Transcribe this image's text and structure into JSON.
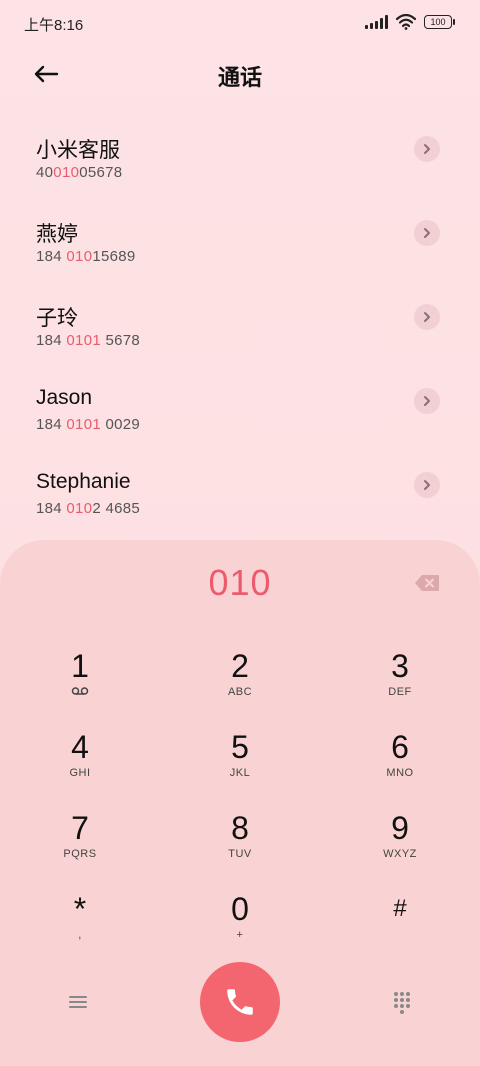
{
  "status": {
    "time": "上午8:16",
    "battery": "100"
  },
  "header": {
    "title": "通话"
  },
  "contacts": [
    {
      "name": "小米客服",
      "num_pre": "40",
      "num_hl": "010",
      "num_post": "05678"
    },
    {
      "name": "燕婷",
      "num_pre": "184 ",
      "num_hl": "010",
      "num_post": "15689"
    },
    {
      "name": "子玲",
      "num_pre": "184 ",
      "num_hl": "0101",
      "num_post": " 5678"
    },
    {
      "name": "Jason",
      "num_pre": "184 ",
      "num_hl": "0101",
      "num_post": " 0029"
    },
    {
      "name": "Stephanie",
      "num_pre": "184 ",
      "num_hl": "010",
      "num_post": "2 4685"
    }
  ],
  "dialer": {
    "entry": "010",
    "keys": [
      {
        "digit": "1",
        "letters": ""
      },
      {
        "digit": "2",
        "letters": "ABC"
      },
      {
        "digit": "3",
        "letters": "DEF"
      },
      {
        "digit": "4",
        "letters": "GHI"
      },
      {
        "digit": "5",
        "letters": "JKL"
      },
      {
        "digit": "6",
        "letters": "MNO"
      },
      {
        "digit": "7",
        "letters": "PQRS"
      },
      {
        "digit": "8",
        "letters": "TUV"
      },
      {
        "digit": "9",
        "letters": "WXYZ"
      },
      {
        "digit": "*",
        "letters": ","
      },
      {
        "digit": "0",
        "letters": "+"
      },
      {
        "digit": "#",
        "letters": ""
      }
    ]
  },
  "colors": {
    "accent": "#ec5a6d",
    "call": "#f4666f"
  }
}
